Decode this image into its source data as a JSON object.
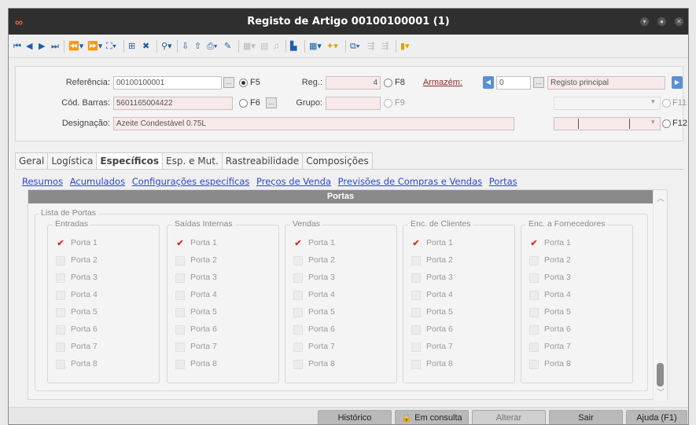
{
  "window": {
    "title": "Registo de Artigo 00100100001 (1)"
  },
  "header": {
    "referencia_label": "Referência:",
    "referencia_value": "00100100001",
    "f5_label": "F5",
    "reg_label": "Reg.:",
    "reg_value": "4",
    "f8_label": "F8",
    "armazem_label": "Armazém:",
    "armazem_value": "0",
    "registo_principal": "Registo principal",
    "cod_barras_label": "Cód. Barras:",
    "cod_barras_value": "5601165004422",
    "f6_label": "F6",
    "grupo_label": "Grupo:",
    "f9_label": "F9",
    "f11_label": "F11",
    "designacao_label": "Designação:",
    "designacao_value": "Azeite Condestável 0.75L",
    "f12_label": "F12"
  },
  "tabs": [
    "Geral",
    "Logística",
    "Específicos",
    "Esp. e Mut.",
    "Rastreabilidade",
    "Composições"
  ],
  "subnav": [
    "Resumos",
    "Acumulados",
    "Configurações específicas",
    "Preços de Venda",
    "Previsões de Compras e Vendas",
    "Portas"
  ],
  "section": {
    "title": "Portas",
    "group_title": "Lista de Portas",
    "columns": [
      {
        "title": "Entradas",
        "items": [
          "Porta 1",
          "Porta 2",
          "Porta 3",
          "Porta 4",
          "Porta 5",
          "Porta 6",
          "Porta 7",
          "Porta 8"
        ],
        "checked": [
          true,
          false,
          false,
          false,
          false,
          false,
          false,
          false
        ]
      },
      {
        "title": "Saídas Internas",
        "items": [
          "Porta 1",
          "Porta 2",
          "Porta 3",
          "Porta 4",
          "Porta 5",
          "Porta 6",
          "Porta 7",
          "Porta 8"
        ],
        "checked": [
          true,
          false,
          false,
          false,
          false,
          false,
          false,
          false
        ]
      },
      {
        "title": "Vendas",
        "items": [
          "Porta 1",
          "Porta 2",
          "Porta 3",
          "Porta 4",
          "Porta 5",
          "Porta 6",
          "Porta 7",
          "Porta 8"
        ],
        "checked": [
          true,
          false,
          false,
          false,
          false,
          false,
          false,
          false
        ]
      },
      {
        "title": "Enc. de Clientes",
        "items": [
          "Porta 1",
          "Porta 2",
          "Porta 3",
          "Porta 4",
          "Porta 5",
          "Porta 6",
          "Porta 7",
          "Porta 8"
        ],
        "checked": [
          true,
          false,
          false,
          false,
          false,
          false,
          false,
          false
        ]
      },
      {
        "title": "Enc. a Fornecedores",
        "items": [
          "Porta 1",
          "Porta 2",
          "Porta 3",
          "Porta 4",
          "Porta 5",
          "Porta 6",
          "Porta 7",
          "Porta 8"
        ],
        "checked": [
          true,
          false,
          false,
          false,
          false,
          false,
          false,
          false
        ]
      }
    ]
  },
  "footer": {
    "historico": "Histórico",
    "em_consulta": "Em consulta",
    "alterar": "Alterar",
    "sair": "Sair",
    "ajuda": "Ajuda (F1)"
  }
}
